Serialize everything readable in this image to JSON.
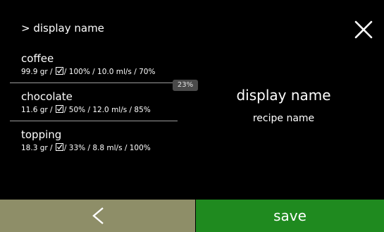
{
  "header": {
    "breadcrumb": "> display name",
    "close_icon": "close-x-icon"
  },
  "ingredients": [
    {
      "name": "coffee",
      "weight": "99.9 gr /",
      "rest": "/ 100% / 10.0 ml/s / 70%"
    },
    {
      "name": "chocolate",
      "weight": "11.6 gr /",
      "rest": "/ 50% / 12.0 ml/s / 85%"
    },
    {
      "name": "topping",
      "weight": "18.3 gr /",
      "rest": "/ 33% / 8.8 ml/s / 100%"
    }
  ],
  "percent_badge": "23%",
  "display": {
    "title": "display name",
    "subtitle": "recipe name"
  },
  "footer": {
    "back_icon": "chevron-left-icon",
    "save_label": "save"
  },
  "colors": {
    "background": "#000000",
    "back_button": "#8e8e68",
    "save_button": "#1f8a1f",
    "badge": "#4a4a4a"
  }
}
